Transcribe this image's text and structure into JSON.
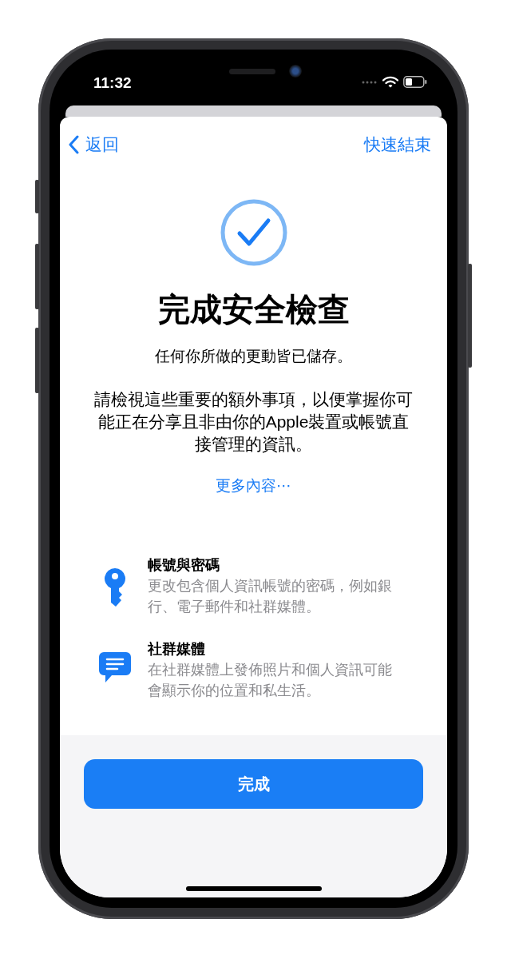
{
  "status_bar": {
    "time": "11:32"
  },
  "nav": {
    "back": "返回",
    "action": "快速結束"
  },
  "title": "完成安全檢查",
  "subtitle": "任何你所做的更動皆已儲存。",
  "body": "請檢視這些重要的額外事項，以便掌握你可能正在分享且非由你的Apple裝置或帳號直接管理的資訊。",
  "link": "更多內容⋯",
  "items": [
    {
      "kind": "key",
      "title": "帳號與密碼",
      "description": "更改包含個人資訊帳號的密碼，例如銀行、電子郵件和社群媒體。"
    },
    {
      "kind": "message",
      "title": "社群媒體",
      "description": "在社群媒體上發佈照片和個人資訊可能會顯示你的位置和私生活。"
    }
  ],
  "button": "完成"
}
